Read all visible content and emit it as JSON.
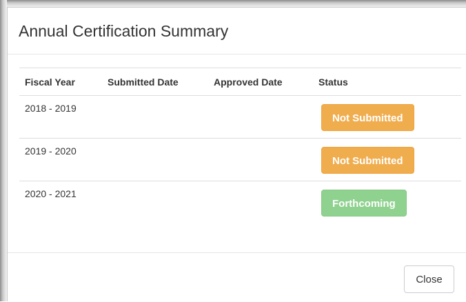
{
  "modal": {
    "title": "Annual Certification Summary"
  },
  "table": {
    "headers": {
      "fiscal_year": "Fiscal Year",
      "submitted_date": "Submitted Date",
      "approved_date": "Approved Date",
      "status": "Status"
    },
    "rows": [
      {
        "fiscal_year": "2018 - 2019",
        "submitted_date": "",
        "approved_date": "",
        "status": "Not Submitted",
        "status_color": "#f0ad4e"
      },
      {
        "fiscal_year": "2019 - 2020",
        "submitted_date": "",
        "approved_date": "",
        "status": "Not Submitted",
        "status_color": "#f0ad4e"
      },
      {
        "fiscal_year": "2020 - 2021",
        "submitted_date": "",
        "approved_date": "",
        "status": "Forthcoming",
        "status_color": "#8fd18f"
      }
    ]
  },
  "footer": {
    "close_label": "Close"
  }
}
